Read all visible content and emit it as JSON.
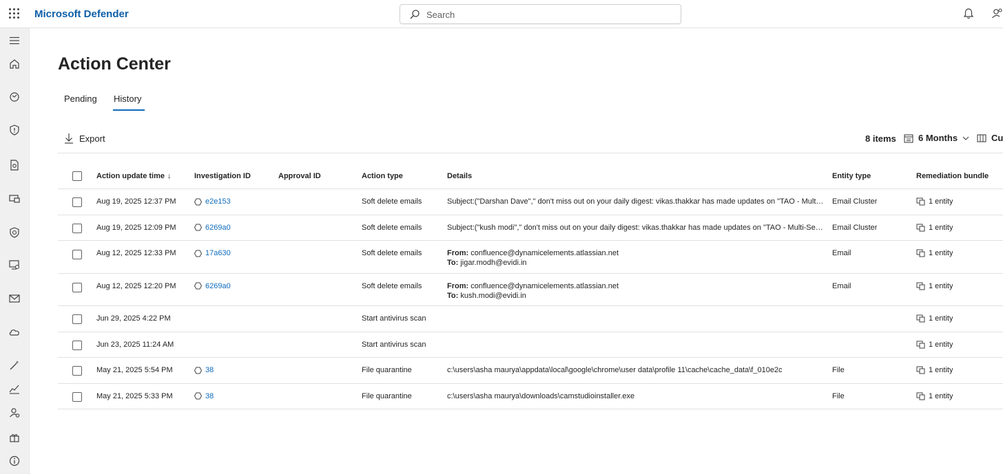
{
  "app": {
    "brand": "Microsoft Defender"
  },
  "search": {
    "placeholder": "Search"
  },
  "page": {
    "title": "Action Center"
  },
  "tabs": [
    {
      "label": "Pending"
    },
    {
      "label": "History"
    }
  ],
  "toolbar": {
    "export_label": "Export",
    "items_count": "8 items",
    "range_label": "6 Months",
    "customize_label": "Cu"
  },
  "table": {
    "headers": {
      "time": "Action update time",
      "time_sort": "↓",
      "investigation": "Investigation ID",
      "approval": "Approval ID",
      "action_type": "Action type",
      "details": "Details",
      "entity_type": "Entity type",
      "bundle": "Remediation bundle"
    },
    "rows": [
      {
        "time": "Aug 19, 2025 12:37 PM",
        "investigation": "e2e153",
        "action_type": "Soft delete emails",
        "details": "Subject:(\"Darshan Dave\",\" don't miss out on your daily digest: vikas.thakkar has made updates on \"TAO - Multi-Servic...",
        "entity_type": "Email Cluster",
        "bundle": "1 entity"
      },
      {
        "time": "Aug 19, 2025 12:09 PM",
        "investigation": "6269a0",
        "action_type": "Soft delete emails",
        "details": "Subject:(\"kush modi\",\" don't miss out on your daily digest: vikas.thakkar has made updates on \"TAO - Multi-Service S...",
        "entity_type": "Email Cluster",
        "bundle": "1 entity"
      },
      {
        "time": "Aug 12, 2025 12:33 PM",
        "investigation": "17a630",
        "action_type": "Soft delete emails",
        "from_label": "From:",
        "from": "confluence@dynamicelements.atlassian.net",
        "to_label": "To:",
        "to": "jigar.modh@evidi.in",
        "entity_type": "Email",
        "bundle": "1 entity"
      },
      {
        "time": "Aug 12, 2025 12:20 PM",
        "investigation": "6269a0",
        "action_type": "Soft delete emails",
        "from_label": "From:",
        "from": "confluence@dynamicelements.atlassian.net",
        "to_label": "To:",
        "to": "kush.modi@evidi.in",
        "entity_type": "Email",
        "bundle": "1 entity"
      },
      {
        "time": "Jun 29, 2025 4:22 PM",
        "investigation": "",
        "action_type": "Start antivirus scan",
        "details": "",
        "entity_type": "",
        "bundle": "1 entity"
      },
      {
        "time": "Jun 23, 2025 11:24 AM",
        "investigation": "",
        "action_type": "Start antivirus scan",
        "details": "",
        "entity_type": "",
        "bundle": "1 entity"
      },
      {
        "time": "May 21, 2025 5:54 PM",
        "investigation": "38",
        "action_type": "File quarantine",
        "details": "c:\\users\\asha maurya\\appdata\\local\\google\\chrome\\user data\\profile 11\\cache\\cache_data\\f_010e2c",
        "entity_type": "File",
        "bundle": "1 entity"
      },
      {
        "time": "May 21, 2025 5:33 PM",
        "investigation": "38",
        "action_type": "File quarantine",
        "details": "c:\\users\\asha maurya\\downloads\\camstudioinstaller.exe",
        "entity_type": "File",
        "bundle": "1 entity"
      }
    ]
  },
  "icons": {
    "rail": [
      "menu-icon",
      "home-icon",
      "incidents-icon",
      "shield-icon",
      "reports-icon",
      "devices-icon",
      "endpoints-icon",
      "assets-icon",
      "email-icon",
      "cloud-icon",
      "wand-icon",
      "analytics-icon",
      "identities-icon",
      "gift-icon",
      "info-icon"
    ]
  },
  "colors": {
    "brand": "#0f5fa8",
    "link": "#0f6cbd",
    "rail_bg": "#f0f0f0"
  }
}
